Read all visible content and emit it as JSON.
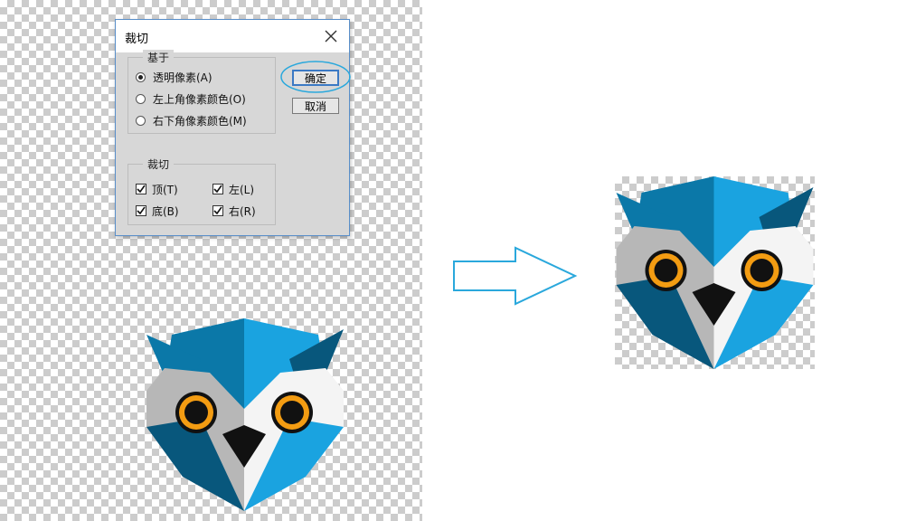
{
  "dialog": {
    "title": "裁切",
    "basis_group": {
      "legend": "基于",
      "options": [
        {
          "label": "透明像素(A)",
          "selected": true
        },
        {
          "label": "左上角像素颜色(O)",
          "selected": false
        },
        {
          "label": "右下角像素颜色(M)",
          "selected": false
        }
      ]
    },
    "crop_group": {
      "legend": "裁切",
      "options": [
        {
          "label": "顶(T)",
          "checked": true
        },
        {
          "label": "左(L)",
          "checked": true
        },
        {
          "label": "底(B)",
          "checked": true
        },
        {
          "label": "右(R)",
          "checked": true
        }
      ]
    },
    "ok_label": "确定",
    "cancel_label": "取消"
  },
  "icons": {
    "close": "close-icon",
    "arrow": "right-arrow-icon",
    "owl": "owl-logo"
  },
  "colors": {
    "owl_dark_blue": "#0b78a8",
    "owl_light_blue": "#1aa3e0",
    "owl_deep_blue": "#08577c",
    "eye_orange": "#f39c12",
    "highlight": "#2aa8dc"
  }
}
